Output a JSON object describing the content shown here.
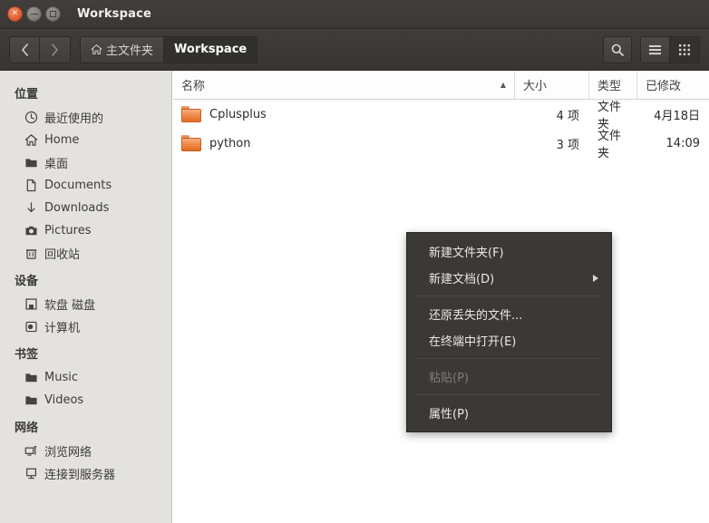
{
  "window": {
    "title": "Workspace",
    "controls": {
      "close": "close-button",
      "minimize": "minimize-button",
      "maximize": "maximize-button"
    }
  },
  "toolbar": {
    "back_label": "‹",
    "forward_label": "›",
    "breadcrumbs": [
      {
        "label": "主文件夹",
        "icon": "home-icon",
        "active": false
      },
      {
        "label": "Workspace",
        "icon": "",
        "active": true
      }
    ],
    "search_label": "search-icon",
    "list_view_label": "list-view-icon",
    "grid_view_label": "grid-view-icon"
  },
  "sidebar": {
    "sections": [
      {
        "title": "位置",
        "items": [
          {
            "label": "最近使用的",
            "icon": "clock-icon"
          },
          {
            "label": "Home",
            "icon": "home-icon"
          },
          {
            "label": "桌面",
            "icon": "folder-icon"
          },
          {
            "label": "Documents",
            "icon": "document-icon"
          },
          {
            "label": "Downloads",
            "icon": "download-icon"
          },
          {
            "label": "Pictures",
            "icon": "camera-icon"
          },
          {
            "label": "回收站",
            "icon": "trash-icon"
          }
        ]
      },
      {
        "title": "设备",
        "items": [
          {
            "label": "软盘 磁盘",
            "icon": "floppy-disk-icon"
          },
          {
            "label": "计算机",
            "icon": "computer-icon"
          }
        ]
      },
      {
        "title": "书签",
        "items": [
          {
            "label": "Music",
            "icon": "folder-icon"
          },
          {
            "label": "Videos",
            "icon": "folder-icon"
          }
        ]
      },
      {
        "title": "网络",
        "items": [
          {
            "label": "浏览网络",
            "icon": "network-icon"
          },
          {
            "label": "连接到服务器",
            "icon": "server-icon"
          }
        ]
      }
    ]
  },
  "filelist": {
    "columns": [
      {
        "label": "名称",
        "sorted": "ascending",
        "sort_glyph": "▲"
      },
      {
        "label": "大小"
      },
      {
        "label": "类型"
      },
      {
        "label": "已修改"
      }
    ],
    "rows": [
      {
        "name": "Cplusplus",
        "size": "4 项",
        "type": "文件夹",
        "modified": "4月18日",
        "icon": "folder-icon"
      },
      {
        "name": "python",
        "size": "3 项",
        "type": "文件夹",
        "modified": "14:09",
        "icon": "folder-icon"
      }
    ]
  },
  "context_menu": {
    "items": [
      {
        "label": "新建文件夹(F)",
        "disabled": false,
        "submenu": false
      },
      {
        "label": "新建文档(D)",
        "disabled": false,
        "submenu": true
      },
      {
        "label": "还原丢失的文件...",
        "disabled": false,
        "submenu": false
      },
      {
        "label": "在终端中打开(E)",
        "disabled": false,
        "submenu": false
      },
      {
        "label": "粘贴(P)",
        "disabled": true,
        "submenu": false
      },
      {
        "label": "属性(P)",
        "disabled": false,
        "submenu": false
      }
    ]
  },
  "colors": {
    "titlebar": "#3d3a37",
    "toolbar": "#3c3936",
    "sidebar": "#e4e2df",
    "menu_bg": "#3b3935",
    "folder_orange": "#ef8c4e",
    "close_button": "#e2613a"
  }
}
